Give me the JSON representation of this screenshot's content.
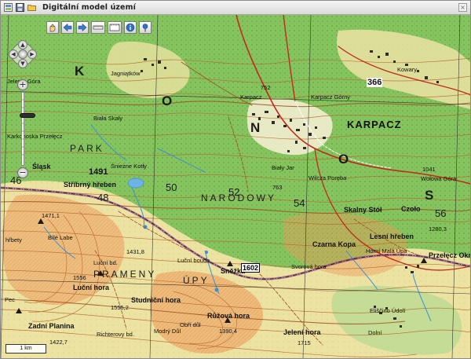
{
  "window": {
    "title": "Digitální model území",
    "titlebar_icons": [
      "app-icon",
      "save-icon",
      "folder-icon"
    ]
  },
  "toolbar": {
    "tools": [
      {
        "name": "hand-pan-icon"
      },
      {
        "name": "back-arrow-icon"
      },
      {
        "name": "forward-arrow-icon"
      },
      {
        "name": "measure-icon"
      },
      {
        "name": "measure-area-icon"
      },
      {
        "name": "info-icon"
      },
      {
        "name": "pin-icon"
      }
    ]
  },
  "navigation": {
    "zoom_in_label": "+",
    "zoom_out_label": "−",
    "zoom_level": 0.3
  },
  "map": {
    "labels": {
      "k": "K",
      "o1": "O",
      "n": "N",
      "o2": "O",
      "s": "S",
      "park": "PARK",
      "narodowy": "NARODOWY",
      "prameny": "PRAMENY",
      "upy": "ÚPY",
      "karpacz": "KARPACZ",
      "snezka": "Sněžka",
      "elev_1602": "1602",
      "stribrny": "Stříbrný hřeben",
      "slask": "Śląsk",
      "karkonoska": "Karkonoska Przełęcz",
      "biala_skaly": "Biała Skały",
      "jelenia": "Jelenia Góra",
      "malbork": "Lesní hřeben",
      "przelecz": "Przełęcz Okraj",
      "skalny": "Skalny Stół",
      "czarna": "Czarna Kopa",
      "svorova": "Svorová hora",
      "rozova": "Růžová hora",
      "lucni_bouda": "Luční bd.",
      "lucni_hora": "Luční hora",
      "studnicni": "Studniční hora",
      "zadni_planina": "Zadní Planina",
      "richterovy": "Richterovy bd.",
      "jeleni_hora": "Jelení hora",
      "elisciny": "Eliščino Údolí",
      "mala_upa": "Horní Malá Úpa",
      "upper_label": "Kowary",
      "karpacz_g": "Karpacz Górny",
      "wolowa": "Wołowa Góra",
      "bialy": "Biały Jar",
      "biala_labe": "Bílé Labe",
      "hybsky": "hřbety",
      "rezy": "Pec",
      "czeta": "Czoło",
      "doube": "Dolní",
      "rychlo": "Śnieżne Kotły",
      "wilcza": "Wilcza Poręba",
      "luc": "Luční bouda",
      "modre": "Modrý Důl",
      "obri": "Obří důl",
      "karp": "Karpacz",
      "jagnia": "Jagniątków"
    },
    "grid_numbers": {
      "g46": "46",
      "g48": "48",
      "g50": "50",
      "g52": "52",
      "g54": "54",
      "g56": "56",
      "g1491": "1491",
      "g366": "366"
    },
    "elevations": {
      "e1471": "1471,1",
      "e1556": "1556",
      "e1390": "1390,4",
      "e1422": "1422,7",
      "e1280": "1280,3",
      "e1041": "1041",
      "e752": "752",
      "e763": "763",
      "e1715": "1715",
      "e1555": "1555,2",
      "e1431": "1431,8"
    }
  },
  "scale_bar": {
    "label": "1 km"
  },
  "colors": {
    "forest": "#7fbf5a",
    "open": "#e7df9c",
    "contour": "#b8662a",
    "water": "#3a90d6",
    "road": "#c22a1a",
    "border": "#7d2a82"
  }
}
